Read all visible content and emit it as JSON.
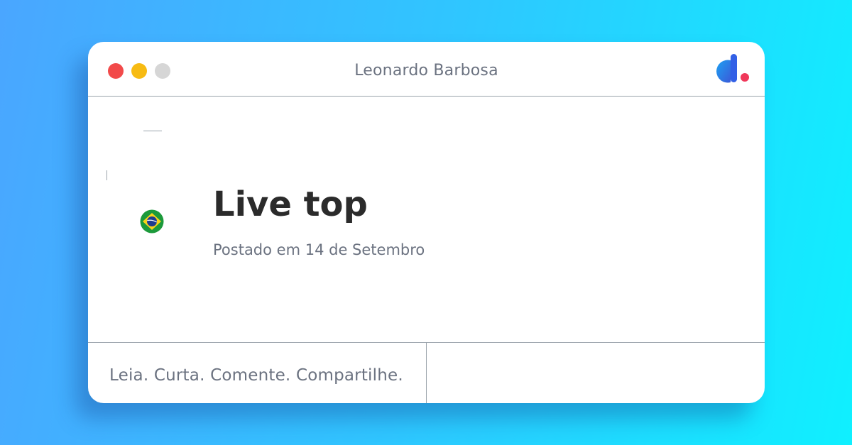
{
  "window": {
    "title": "Leonardo Barbosa",
    "controls": [
      "close",
      "minimize",
      "maximize"
    ]
  },
  "logo": {
    "icon": "d-logo-icon",
    "colors": {
      "primary": "#2f7cf6",
      "accent": "#f0385a"
    }
  },
  "post": {
    "title": "Live top",
    "date": "Postado em 14 de Setembro",
    "country_flag_icon": "brazil-flag-icon"
  },
  "footer": {
    "tagline": "Leia. Curta. Comente. Compartilhe."
  }
}
